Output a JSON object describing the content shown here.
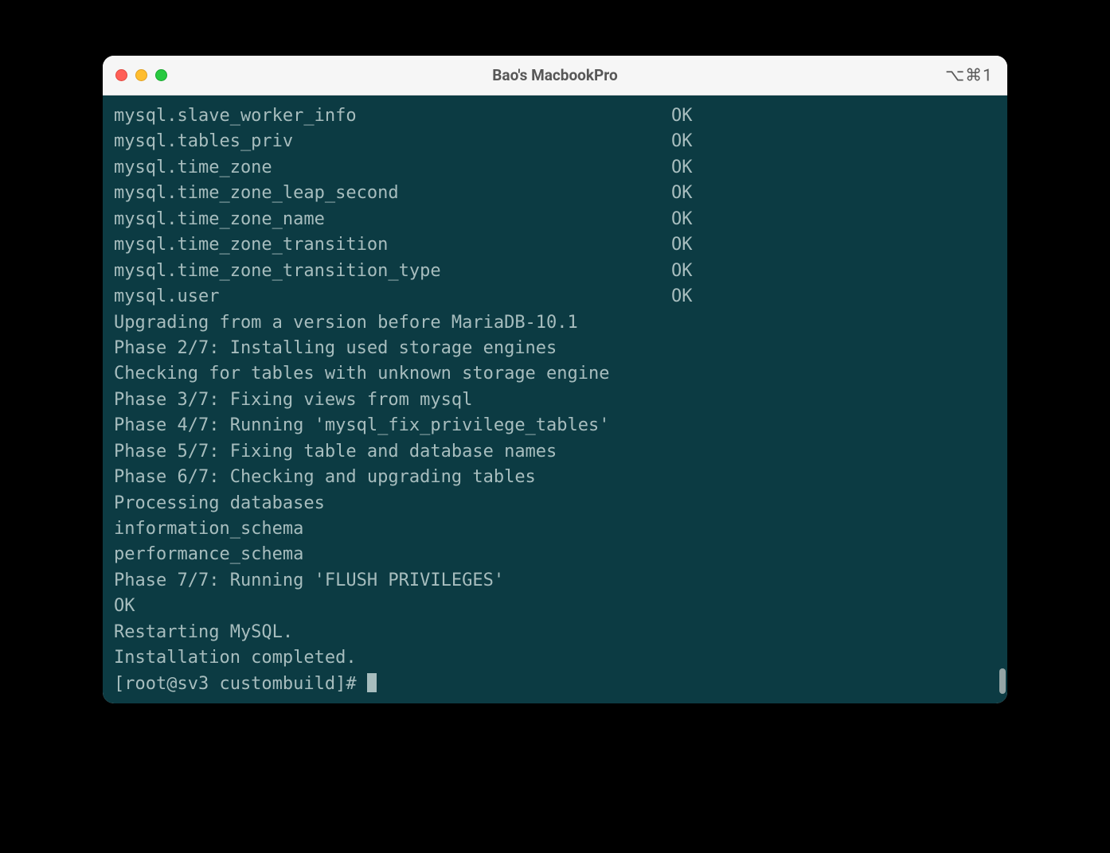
{
  "window": {
    "title": "Bao's MacbookPro",
    "shortcut": "⌥⌘1"
  },
  "terminal": {
    "tables": [
      {
        "name": "mysql.slave_worker_info",
        "status": "OK"
      },
      {
        "name": "mysql.tables_priv",
        "status": "OK"
      },
      {
        "name": "mysql.time_zone",
        "status": "OK"
      },
      {
        "name": "mysql.time_zone_leap_second",
        "status": "OK"
      },
      {
        "name": "mysql.time_zone_name",
        "status": "OK"
      },
      {
        "name": "mysql.time_zone_transition",
        "status": "OK"
      },
      {
        "name": "mysql.time_zone_transition_type",
        "status": "OK"
      },
      {
        "name": "mysql.user",
        "status": "OK"
      }
    ],
    "lines": [
      "Upgrading from a version before MariaDB-10.1",
      "Phase 2/7: Installing used storage engines",
      "Checking for tables with unknown storage engine",
      "Phase 3/7: Fixing views from mysql",
      "Phase 4/7: Running 'mysql_fix_privilege_tables'",
      "Phase 5/7: Fixing table and database names",
      "Phase 6/7: Checking and upgrading tables",
      "Processing databases",
      "information_schema",
      "performance_schema",
      "Phase 7/7: Running 'FLUSH PRIVILEGES'",
      "OK",
      "Restarting MySQL.",
      "Installation completed."
    ],
    "prompt": "[root@sv3 custombuild]# "
  }
}
